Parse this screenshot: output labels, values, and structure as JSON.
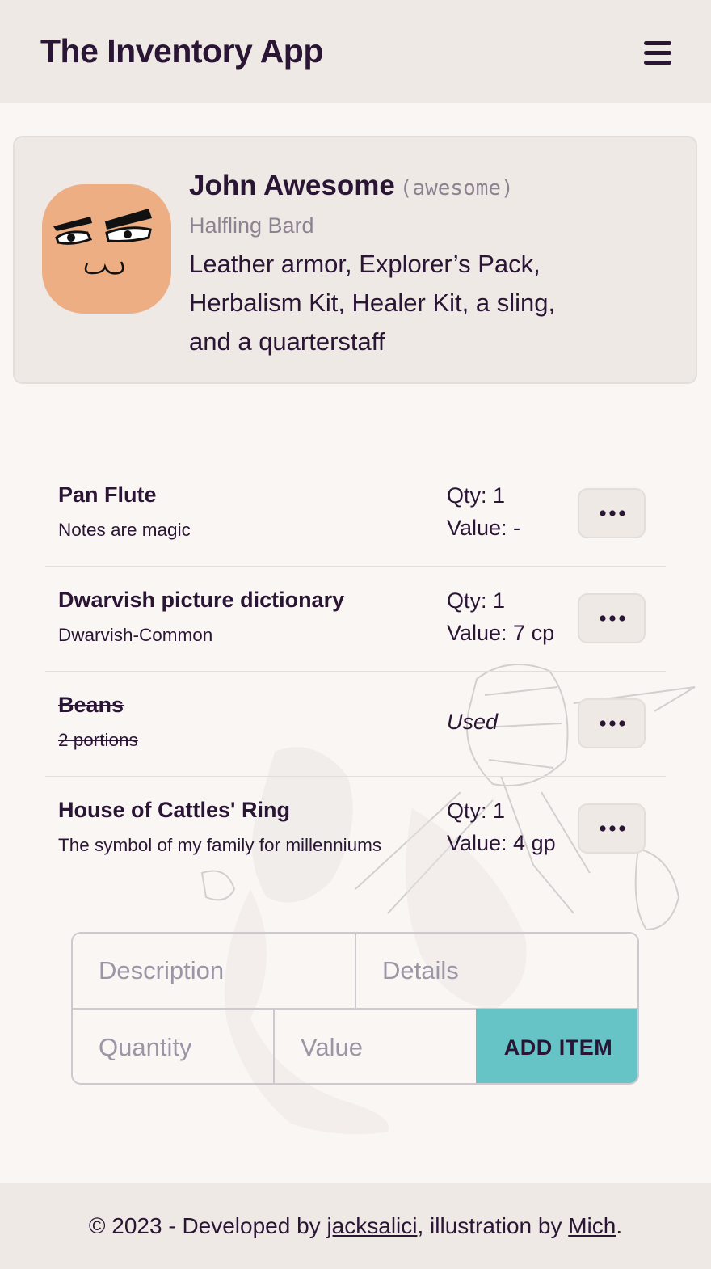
{
  "app": {
    "title": "The Inventory App",
    "menu_icon": "hamburger-menu-icon"
  },
  "profile": {
    "name": "John Awesome",
    "handle": "(awesome)",
    "subtitle": "Halfling Bard",
    "equipment": "Leather armor, Explorer’s Pack, Herbalism Kit, Healer Kit, a sling, and a quarterstaff",
    "avatar_icon": "face-avatar-icon",
    "avatar_color": "#ecae82"
  },
  "items": [
    {
      "name": "Pan Flute",
      "details": "Notes are magic",
      "qty": "Qty: 1",
      "value": "Value: -",
      "status": ""
    },
    {
      "name": "Dwarvish picture dictionary",
      "details": "Dwarvish-Common",
      "qty": "Qty: 1",
      "value": "Value: 7 cp",
      "status": ""
    },
    {
      "name": "Beans",
      "details": "2 portions",
      "qty": "",
      "value": "",
      "status": "Used"
    },
    {
      "name": "House of Cattles' Ring",
      "details": "The symbol of my family for millenniums",
      "qty": "Qty: 1",
      "value": "Value: 4 gp",
      "status": ""
    }
  ],
  "more_icon": "more-dots-icon",
  "form": {
    "description_placeholder": "Description",
    "details_placeholder": "Details",
    "quantity_placeholder": "Quantity",
    "value_placeholder": "Value",
    "add_label": "ADD ITEM",
    "accent": "#66c3c6"
  },
  "footer": {
    "prefix": "© 2023 - Developed by ",
    "dev_link": "jacksalici",
    "middle": ", illustration by ",
    "illus_link": "Mich",
    "suffix": "."
  },
  "colors": {
    "text": "#2a1535",
    "muted": "#8c8290",
    "panel": "#efe9e6",
    "background": "#faf6f3"
  }
}
